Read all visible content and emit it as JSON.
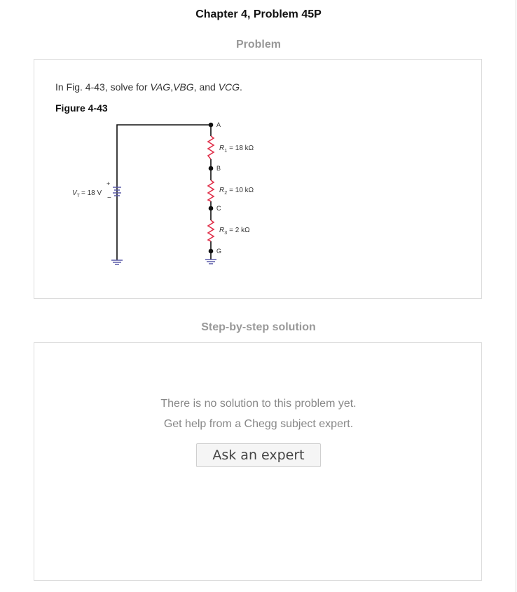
{
  "header": {
    "title": "Chapter 4, Problem 45P"
  },
  "problem": {
    "section_label": "Problem",
    "question_prefix": "In Fig. 4-43, solve for ",
    "var1": "VAG",
    "sep1": ",",
    "var2": "VBG",
    "sep2": ", and ",
    "var3": "VCG",
    "question_suffix": ".",
    "figure_label": "Figure 4-43",
    "circuit": {
      "source_label_main": "V",
      "source_label_sub": "T",
      "source_value": "= 18 V",
      "plus": "+",
      "minus": "−",
      "nodes": [
        "A",
        "B",
        "C",
        "G"
      ],
      "resistors": [
        {
          "name": "R",
          "sub": "1",
          "value": "= 18 kΩ"
        },
        {
          "name": "R",
          "sub": "2",
          "value": "= 10 kΩ"
        },
        {
          "name": "R",
          "sub": "3",
          "value": "= 2 kΩ"
        }
      ],
      "colors": {
        "wire": "#111111",
        "resistor": "#e0304a",
        "ground": "#5a5aa8",
        "battery": "#5a5aa8"
      }
    }
  },
  "solution": {
    "section_label": "Step-by-step solution",
    "message_line1": "There is no solution to this problem yet.",
    "message_line2": "Get help from a Chegg subject expert.",
    "ask_button": "Ask an expert"
  }
}
